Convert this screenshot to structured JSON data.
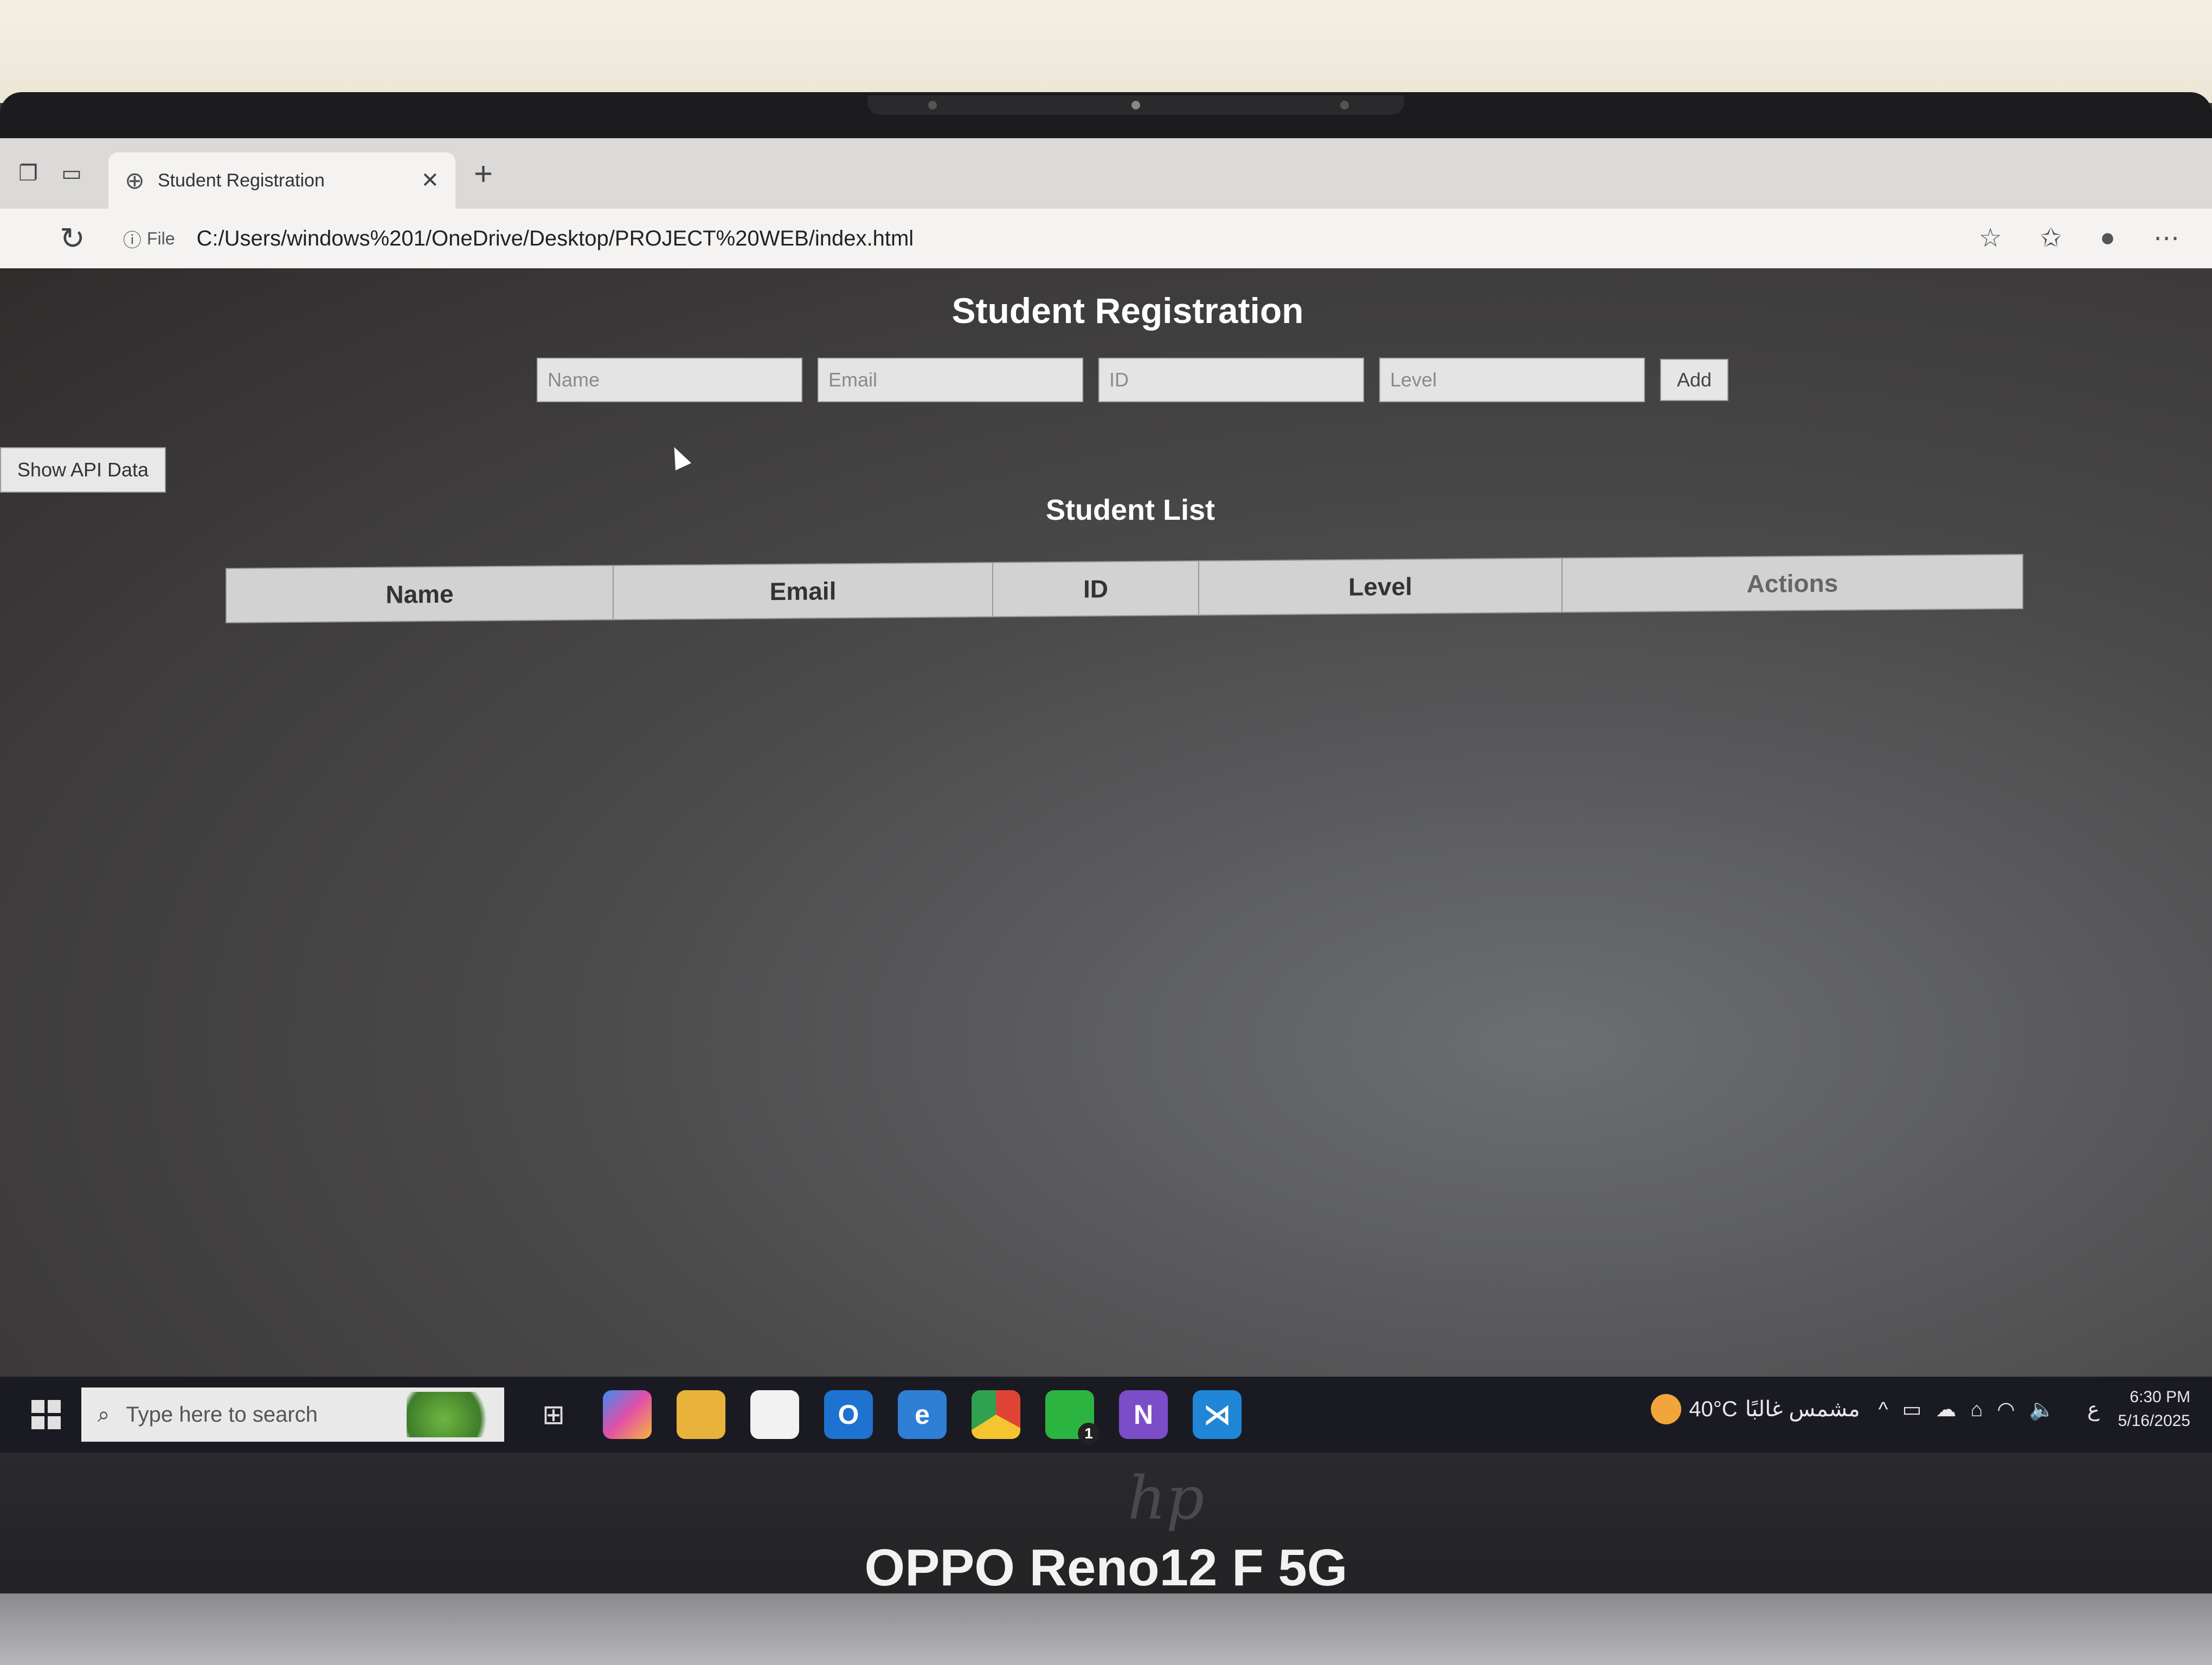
{
  "browser": {
    "tab_title": "Student Registration",
    "address_prefix": "File",
    "url": "C:/Users/windows%201/OneDrive/Desktop/PROJECT%20WEB/index.html"
  },
  "page": {
    "title": "Student Registration",
    "form": {
      "name_placeholder": "Name",
      "email_placeholder": "Email",
      "id_placeholder": "ID",
      "level_placeholder": "Level",
      "add_label": "Add"
    },
    "api_button": "Show API Data",
    "list_title": "Student List",
    "table_headers": [
      "Name",
      "Email",
      "ID",
      "Level",
      "Actions"
    ]
  },
  "taskbar": {
    "search_placeholder": "Type here to search",
    "weather_temp": "40°C",
    "weather_text": "مشمس غالبًا",
    "lang": "ع",
    "time": "6:30 PM",
    "date": "5/16/2025",
    "whatsapp_badge": "1"
  },
  "device": {
    "watermark": "OPPO Reno12 F 5G"
  },
  "colors": {
    "page_bg": "#3b3838",
    "table_header_bg": "#d2d2d2",
    "title_text": "#ffffff"
  }
}
